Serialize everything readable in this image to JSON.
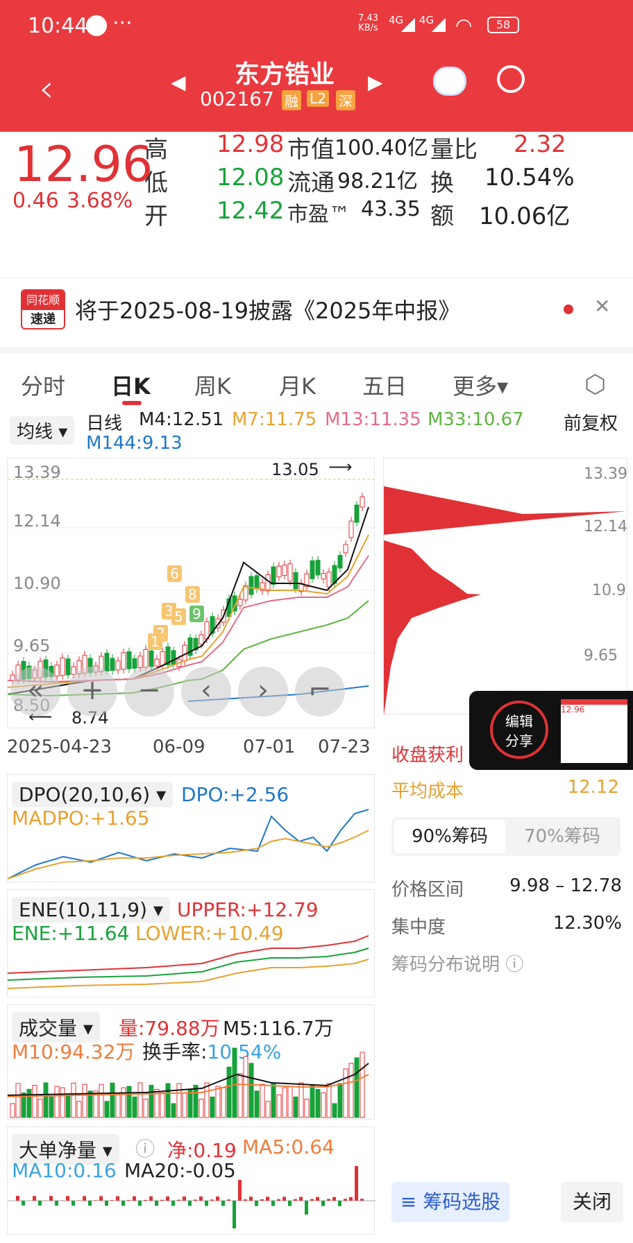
{
  "status": {
    "time": "10:44",
    "net_speed_top": "7.43",
    "net_speed_bottom": "KB/s",
    "signal1": "4G",
    "signal2": "4G",
    "battery": "58",
    "dots": "···"
  },
  "header": {
    "title": "东方锆业",
    "code": "002167",
    "tags": [
      "融",
      "L2",
      "深"
    ]
  },
  "quote": {
    "price": "12.96",
    "change": "0.46",
    "change_pct": "3.68%",
    "rows": [
      {
        "l1": "高",
        "v1": "12.98",
        "l2": "市值",
        "v2": "100.40亿",
        "l3": "量比",
        "v3": "2.32"
      },
      {
        "l1": "低",
        "v1": "12.08",
        "l2": "流通",
        "v2": "98.21亿",
        "l3": "换",
        "v3": "10.54%"
      },
      {
        "l1": "开",
        "v1": "12.42",
        "l2": "市盈™",
        "v2": "43.35",
        "l3": "额",
        "v3": "10.06亿"
      }
    ]
  },
  "notice": {
    "logo_top": "同花顺",
    "logo_bottom": "速递",
    "text": "将于2025-08-19披露《2025年中报》",
    "close": "✕"
  },
  "tabs": {
    "items": [
      "分时",
      "日K",
      "周K",
      "月K",
      "五日",
      "更多▾"
    ],
    "active": 1,
    "settings_icon": "settings-hexagon-icon"
  },
  "ma": {
    "selector": "均线",
    "period": "日线",
    "m4": "M4:12.51",
    "m7": "M7:11.75",
    "m13": "M13:11.35",
    "m33": "M33:10.67",
    "m144": "M144:9.13",
    "adjust": "前复权"
  },
  "kchart": {
    "y_labels": [
      "13.39",
      "12.14",
      "10.90",
      "9.65",
      "8.50"
    ],
    "high_label": "13.05",
    "low_label": "8.74",
    "dates": [
      "2025-04-23",
      "06-09",
      "07-01",
      "07-23"
    ],
    "markers": [
      "1",
      "2",
      "3",
      "5",
      "6",
      "8",
      "9"
    ],
    "controls": [
      "«",
      "+",
      "−",
      "‹",
      "›",
      "⌐"
    ]
  },
  "chips": {
    "y_labels": [
      "13.39",
      "12.14",
      "10.9",
      "9.65"
    ],
    "profit_label": "收盘获利",
    "avg_cost_label": "平均成本",
    "avg_cost": "12.12",
    "tab1": "90%筹码",
    "tab2": "70%筹码",
    "range_label": "价格区间",
    "range": "9.98 – 12.78",
    "conc_label": "集中度",
    "conc": "12.30%",
    "explain": "筹码分布说明 ⓘ",
    "pick_btn": "筹码选股",
    "close_btn": "关闭"
  },
  "share": {
    "label_top": "编辑",
    "label_bottom": "分享",
    "thumb_price": "12.96"
  },
  "dpo": {
    "name": "DPO(20,10,6)",
    "dpo": "DPO:+2.56",
    "madpo": "MADPO:+1.65"
  },
  "ene": {
    "name": "ENE(10,11,9)",
    "upper": "UPPER:+12.79",
    "ene": "ENE:+11.64",
    "lower": "LOWER:+10.49"
  },
  "vol": {
    "name": "成交量",
    "vol": "量:79.88万",
    "m5": "M5:116.7万",
    "m10": "M10:94.32万",
    "turn_label": "换手率:",
    "turn": "10.54%"
  },
  "big": {
    "name": "大单净量",
    "net": "净:0.19",
    "ma5": "MA5:0.64",
    "ma10": "MA10:0.16",
    "ma20": "MA20:-0.05"
  }
}
